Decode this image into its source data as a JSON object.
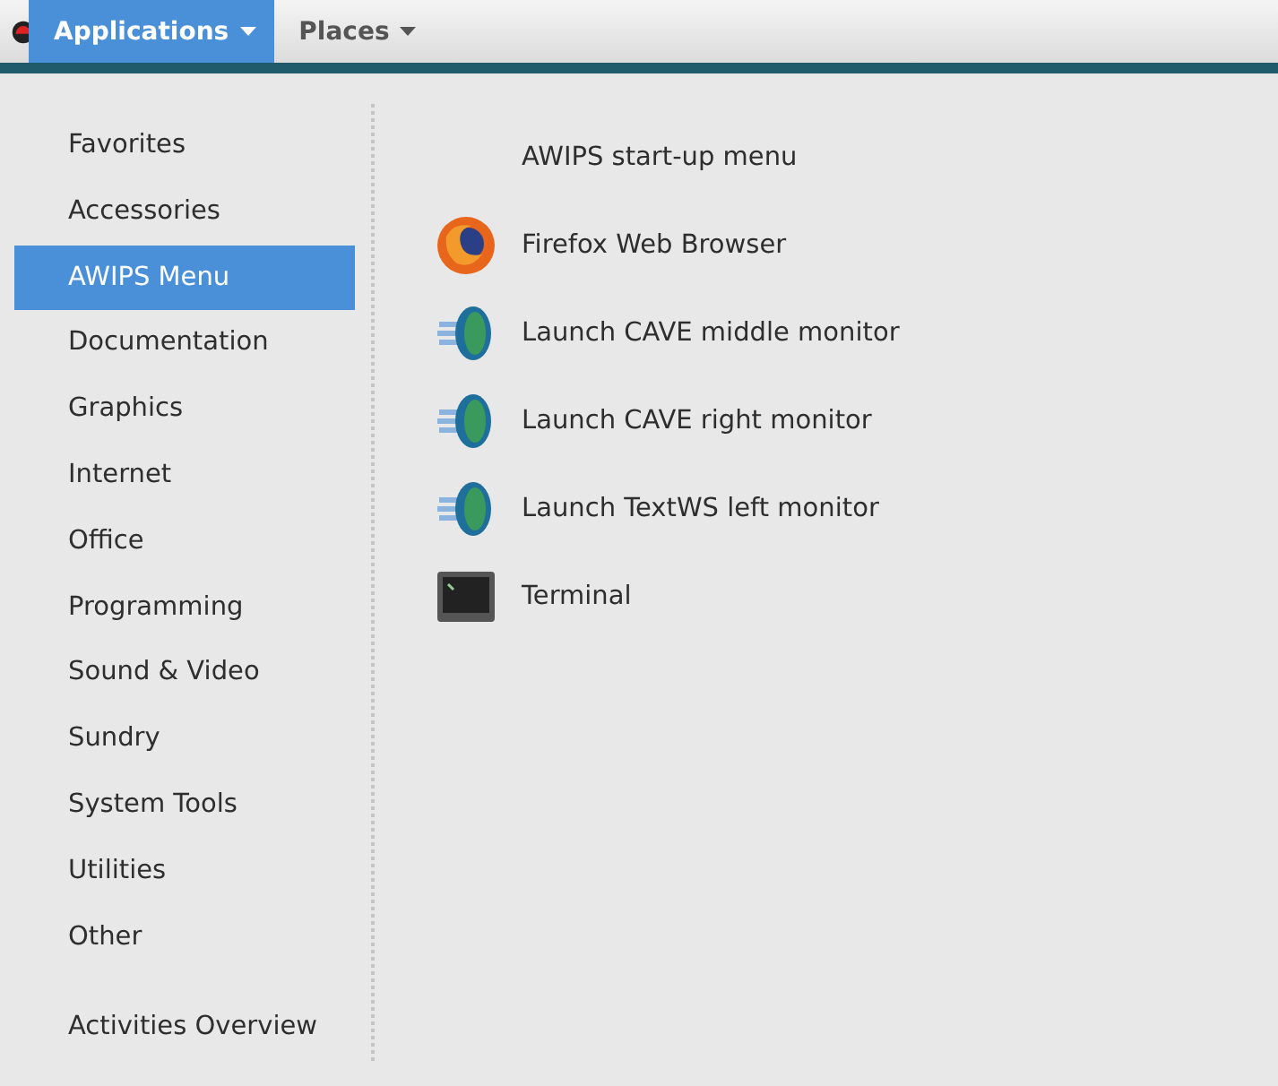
{
  "top_bar": {
    "menus": [
      {
        "label": "Applications",
        "selected": true
      },
      {
        "label": "Places",
        "selected": false
      }
    ]
  },
  "categories": [
    {
      "label": "Favorites",
      "selected": false
    },
    {
      "label": "Accessories",
      "selected": false
    },
    {
      "label": "AWIPS Menu",
      "selected": true
    },
    {
      "label": "Documentation",
      "selected": false
    },
    {
      "label": "Graphics",
      "selected": false
    },
    {
      "label": "Internet",
      "selected": false
    },
    {
      "label": "Office",
      "selected": false
    },
    {
      "label": "Programming",
      "selected": false
    },
    {
      "label": "Sound & Video",
      "selected": false
    },
    {
      "label": "Sundry",
      "selected": false
    },
    {
      "label": "System Tools",
      "selected": false
    },
    {
      "label": "Utilities",
      "selected": false
    },
    {
      "label": "Other",
      "selected": false
    }
  ],
  "activities_overview": "Activities Overview",
  "apps": [
    {
      "kind": "none",
      "label": "AWIPS start-up menu"
    },
    {
      "kind": "firefox",
      "label": "Firefox Web Browser"
    },
    {
      "kind": "globe",
      "label": "Launch CAVE middle monitor"
    },
    {
      "kind": "globe",
      "label": "Launch CAVE right monitor"
    },
    {
      "kind": "globe",
      "label": "Launch TextWS left monitor"
    },
    {
      "kind": "terminal",
      "label": "Terminal"
    }
  ]
}
